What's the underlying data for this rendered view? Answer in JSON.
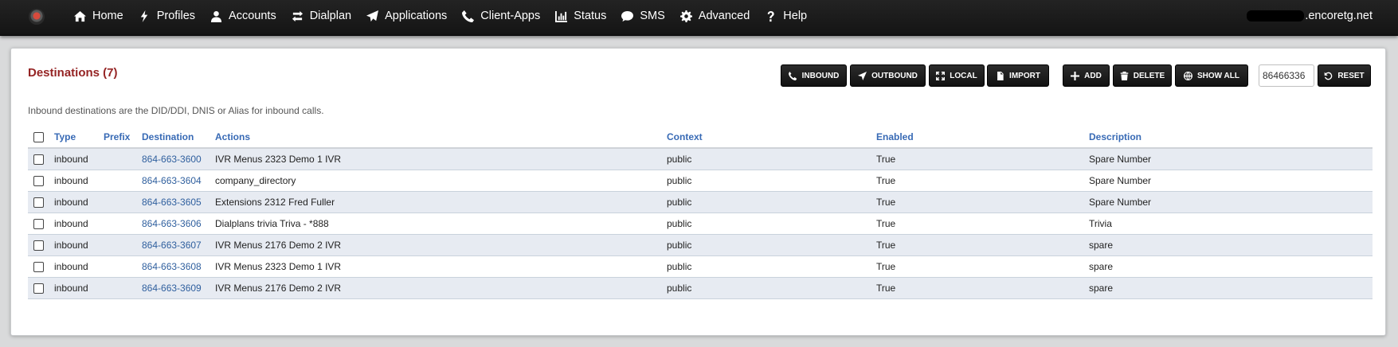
{
  "nav": {
    "items": [
      {
        "label": "Home",
        "icon": "home-icon"
      },
      {
        "label": "Profiles",
        "icon": "bolt-icon"
      },
      {
        "label": "Accounts",
        "icon": "user-icon"
      },
      {
        "label": "Dialplan",
        "icon": "exchange-icon"
      },
      {
        "label": "Applications",
        "icon": "paper-plane-icon"
      },
      {
        "label": "Client-Apps",
        "icon": "phone-icon"
      },
      {
        "label": "Status",
        "icon": "bar-chart-icon"
      },
      {
        "label": "SMS",
        "icon": "comment-icon"
      },
      {
        "label": "Advanced",
        "icon": "gear-icon"
      },
      {
        "label": "Help",
        "icon": "question-icon"
      }
    ],
    "domain": ".encoretg.net"
  },
  "page": {
    "title": "Destinations (7)",
    "description": "Inbound destinations are the DID/DDI, DNIS or Alias for inbound calls."
  },
  "toolbar": {
    "inbound_label": "INBOUND",
    "outbound_label": "OUTBOUND",
    "local_label": "LOCAL",
    "import_label": "IMPORT",
    "add_label": "ADD",
    "delete_label": "DELETE",
    "show_all_label": "SHOW ALL",
    "search_value": "86466336",
    "reset_label": "RESET"
  },
  "table": {
    "headers": {
      "type": "Type",
      "prefix": "Prefix",
      "destination": "Destination",
      "actions": "Actions",
      "context": "Context",
      "enabled": "Enabled",
      "description": "Description"
    },
    "rows": [
      {
        "type": "inbound",
        "prefix": "",
        "destination": "864-663-3600",
        "actions": "IVR Menus 2323 Demo 1 IVR",
        "context": "public",
        "enabled": "True",
        "description": "Spare Number"
      },
      {
        "type": "inbound",
        "prefix": "",
        "destination": "864-663-3604",
        "actions": "company_directory",
        "context": "public",
        "enabled": "True",
        "description": "Spare Number"
      },
      {
        "type": "inbound",
        "prefix": "",
        "destination": "864-663-3605",
        "actions": "Extensions 2312 Fred Fuller",
        "context": "public",
        "enabled": "True",
        "description": "Spare Number"
      },
      {
        "type": "inbound",
        "prefix": "",
        "destination": "864-663-3606",
        "actions": "Dialplans trivia Triva - *888",
        "context": "public",
        "enabled": "True",
        "description": "Trivia"
      },
      {
        "type": "inbound",
        "prefix": "",
        "destination": "864-663-3607",
        "actions": "IVR Menus 2176 Demo 2 IVR",
        "context": "public",
        "enabled": "True",
        "description": "spare"
      },
      {
        "type": "inbound",
        "prefix": "",
        "destination": "864-663-3608",
        "actions": "IVR Menus 2323 Demo 1 IVR",
        "context": "public",
        "enabled": "True",
        "description": "spare"
      },
      {
        "type": "inbound",
        "prefix": "",
        "destination": "864-663-3609",
        "actions": "IVR Menus 2176 Demo 2 IVR",
        "context": "public",
        "enabled": "True",
        "description": "spare"
      }
    ]
  },
  "colors": {
    "title": "#952424",
    "header_link": "#386ab5",
    "destination_link": "#2f5f9e",
    "row_alt": "#e7ebf2",
    "navbar": "#1b1b1b"
  }
}
